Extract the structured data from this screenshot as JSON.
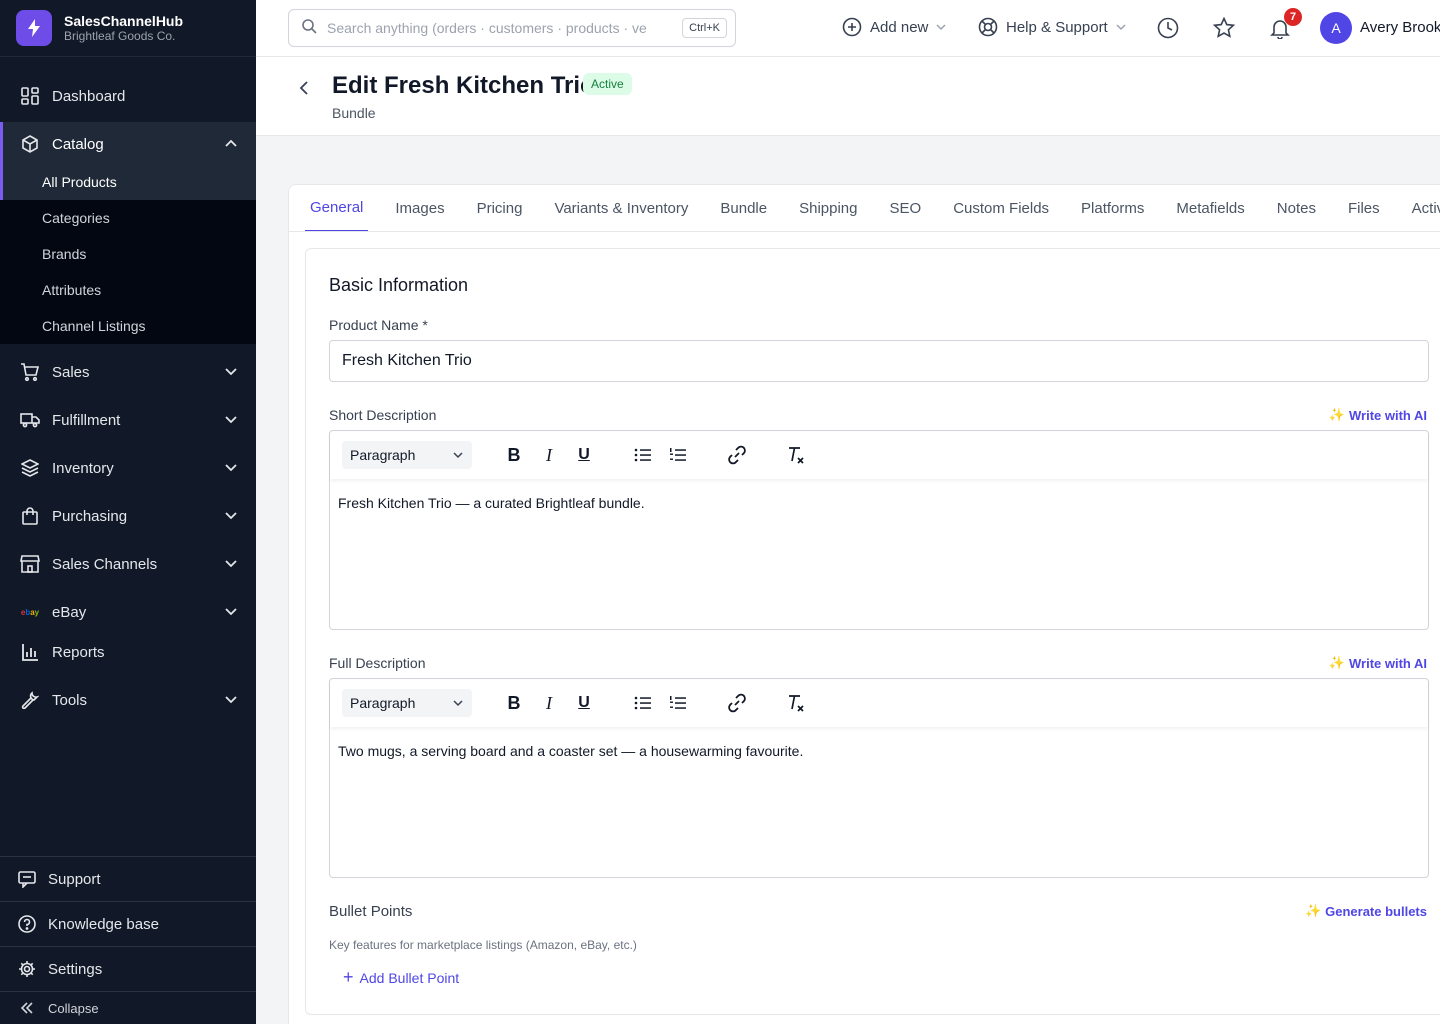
{
  "app": {
    "name": "SalesChannelHub",
    "org": "Brightleaf Goods Co."
  },
  "sidebar": {
    "items": [
      {
        "label": "Dashboard"
      },
      {
        "label": "Catalog"
      },
      {
        "label": "Sales"
      },
      {
        "label": "Fulfillment"
      },
      {
        "label": "Inventory"
      },
      {
        "label": "Purchasing"
      },
      {
        "label": "Sales Channels"
      },
      {
        "label": "eBay"
      },
      {
        "label": "Reports"
      },
      {
        "label": "Tools"
      }
    ],
    "catalog_sub": [
      {
        "label": "All Products"
      },
      {
        "label": "Categories"
      },
      {
        "label": "Brands"
      },
      {
        "label": "Attributes"
      },
      {
        "label": "Channel Listings"
      }
    ],
    "bottom": [
      {
        "label": "Support"
      },
      {
        "label": "Knowledge base"
      },
      {
        "label": "Settings"
      }
    ],
    "collapse_label": "Collapse",
    "accent": "#7c5cf0"
  },
  "topbar": {
    "search_placeholder": "Search anything (orders · customers · products · ve",
    "shortcut": "Ctrl+K",
    "add_new": "Add new",
    "help": "Help & Support",
    "notifications_count": "7",
    "user_initial": "A",
    "user_name": "Avery Brook"
  },
  "header": {
    "title": "Edit Fresh Kitchen Trio",
    "status": "Active",
    "subtitle": "Bundle"
  },
  "tabs": [
    "General",
    "Images",
    "Pricing",
    "Variants & Inventory",
    "Bundle",
    "Shipping",
    "SEO",
    "Custom Fields",
    "Platforms",
    "Metafields",
    "Notes",
    "Files",
    "Activit"
  ],
  "form": {
    "section_title": "Basic Information",
    "product_name_label": "Product Name *",
    "product_name_value": "Fresh Kitchen Trio",
    "short_desc_label": "Short Description",
    "short_desc_ai": "Write with AI",
    "short_desc_format": "Paragraph",
    "short_desc_content": "Fresh Kitchen Trio — a curated Brightleaf bundle.",
    "full_desc_label": "Full Description",
    "full_desc_ai": "Write with AI",
    "full_desc_format": "Paragraph",
    "full_desc_content": "Two mugs, a serving board and a coaster set — a housewarming favourite.",
    "bullets_label": "Bullet Points",
    "bullets_ai": "Generate bullets",
    "bullets_helper": "Key features for marketplace listings (Amazon, eBay, etc.)",
    "add_bullet": "Add Bullet Point"
  }
}
